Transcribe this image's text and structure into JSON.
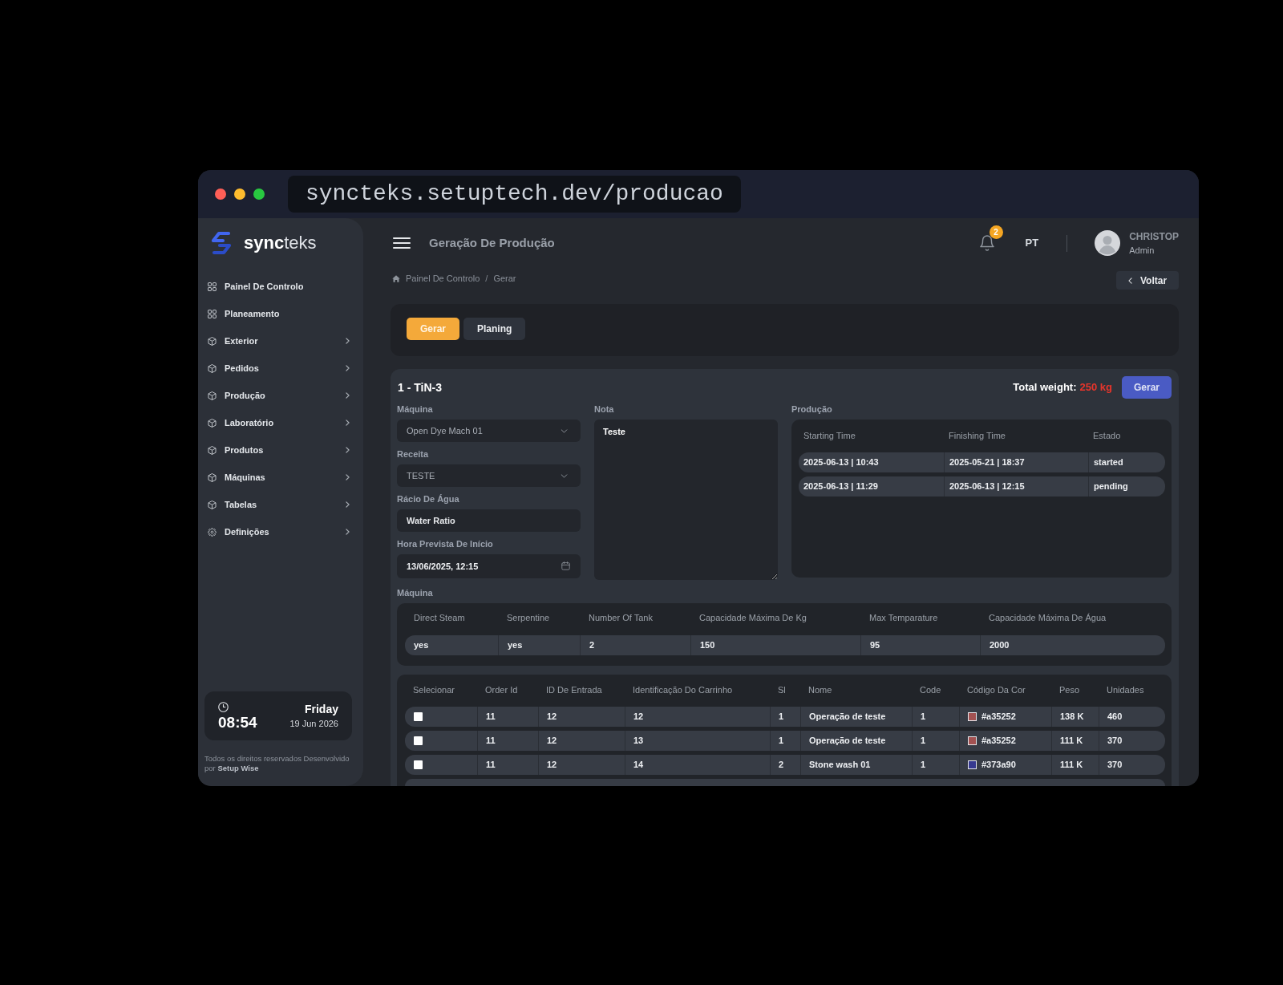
{
  "browser": {
    "url": "syncteks.setuptech.dev/producao"
  },
  "sidebar": {
    "brand": "**sync**teks",
    "items": [
      {
        "label": "Painel De Controlo",
        "kind": "page",
        "selected": false
      },
      {
        "label": "Planeamento",
        "kind": "page",
        "selected": false
      },
      {
        "label": "Exterior",
        "kind": "module",
        "selected": false
      },
      {
        "label": "Pedidos",
        "kind": "module",
        "selected": false
      },
      {
        "label": "Produção",
        "kind": "module",
        "selected": false
      },
      {
        "label": "Laboratório",
        "kind": "module",
        "selected": false
      },
      {
        "label": "Produtos",
        "kind": "module",
        "selected": false
      },
      {
        "label": "Máquinas",
        "kind": "module",
        "selected": false
      },
      {
        "label": "Tabelas",
        "kind": "module",
        "selected": false
      },
      {
        "label": "Definições",
        "kind": "settings",
        "selected": false
      }
    ],
    "clock": {
      "time": "08:54",
      "weekday": "Friday",
      "date": "19 Jun 2026"
    },
    "footer": "Todos os direitos reservados Desenvolvido por **Setup Wise**"
  },
  "header": {
    "title": "Geração De Produção",
    "notification_count": "2",
    "language": "PT",
    "user": {
      "name": "CHRISTOP",
      "role": "Admin"
    }
  },
  "breadcrumb": {
    "items": [
      "Painel De Controlo",
      "Gerar"
    ],
    "separator": "/"
  },
  "back_button": "Voltar",
  "tabs": [
    {
      "label": "Gerar",
      "selected": true
    },
    {
      "label": "Planing",
      "selected": false
    }
  ],
  "card": {
    "title": "1 - TiN-3",
    "total_weight": {
      "label": "Total weight:",
      "value": "250 kg"
    },
    "generate_button": "Gerar",
    "fields": [
      {
        "label": "Máquina",
        "kind": "select",
        "value": "Open Dye Mach 01"
      },
      {
        "label": "Receita",
        "kind": "select",
        "value": "TESTE"
      },
      {
        "label": "Rácio De Água",
        "kind": "text",
        "placeholder": "Water Ratio"
      },
      {
        "label": "Hora Prevista De Início",
        "kind": "datetime",
        "value": "13/06/2025, 12:15"
      }
    ],
    "note": {
      "label": "Nota",
      "value": "Teste"
    },
    "production": {
      "label": "Produção",
      "columns": [
        "Starting Time",
        "Finishing Time",
        "Estado"
      ],
      "rows": [
        [
          "2025-06-13 | 10:43",
          "2025-05-21 | 18:37",
          "started"
        ],
        [
          "2025-06-13 | 11:29",
          "2025-06-13 | 12:15",
          "pending"
        ]
      ]
    },
    "machine": {
      "label": "Máquina",
      "columns": [
        "Direct Steam",
        "Serpentine",
        "Number Of Tank",
        "Capacidade Máxima De Kg",
        "Max Temparature",
        "Capacidade Máxima De Água"
      ],
      "rows": [
        [
          "yes",
          "yes",
          "2",
          "150",
          "95",
          "2000"
        ]
      ]
    },
    "orders": {
      "columns": [
        "Selecionar",
        "Order Id",
        "ID De Entrada",
        "Identificação Do Carrinho",
        "Sl",
        "Nome",
        "Code",
        "Código Da Cor",
        "Peso",
        "Unidades"
      ],
      "rows": [
        {
          "checked": false,
          "order_id": "11",
          "entry_id": "12",
          "cart_id": "12",
          "sl": "1",
          "name": "Operação de teste",
          "code": "1",
          "color": "#a35252",
          "color_code": "#a35252",
          "weight": "138 K",
          "units": "460"
        },
        {
          "checked": false,
          "order_id": "11",
          "entry_id": "12",
          "cart_id": "13",
          "sl": "1",
          "name": "Operação de teste",
          "code": "1",
          "color": "#a35252",
          "color_code": "#a35252",
          "weight": "111 K",
          "units": "370"
        },
        {
          "checked": false,
          "order_id": "11",
          "entry_id": "12",
          "cart_id": "14",
          "sl": "2",
          "name": "Stone wash 01",
          "code": "1",
          "color": "#373a90",
          "color_code": "#373a90",
          "weight": "111 K",
          "units": "370"
        }
      ]
    }
  }
}
